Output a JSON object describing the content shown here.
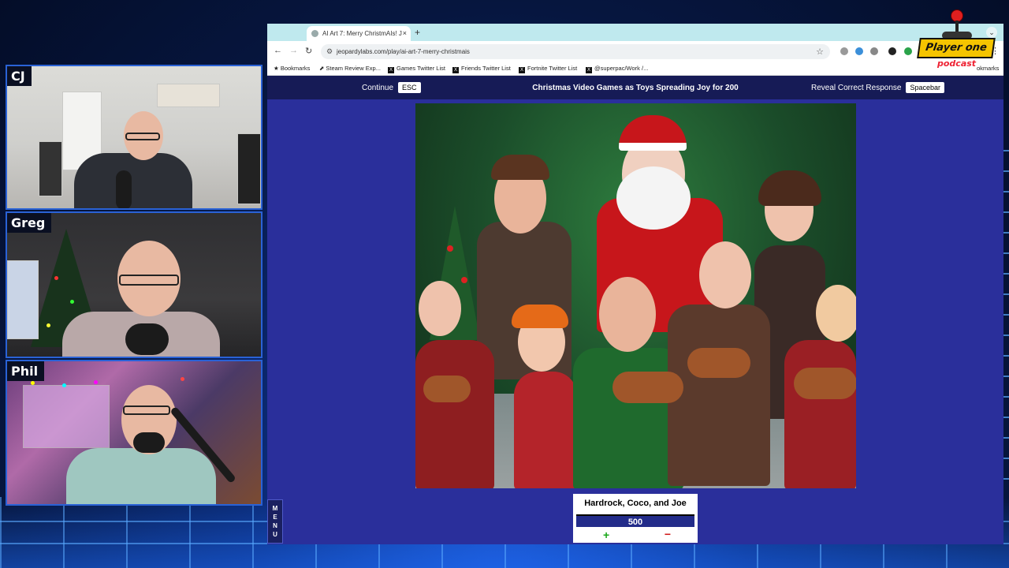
{
  "cams": {
    "cj": "CJ",
    "greg": "Greg",
    "phil": "Phil"
  },
  "browser": {
    "tab_title": "AI Art 7: Merry ChristmAIs! J",
    "tab_close": "×",
    "new_tab": "+",
    "url": "jeopardylabs.com/play/ai-art-7-merry-christmais",
    "bookmarks": [
      "Bookmarks",
      "Steam Review Exp...",
      "Games Twitter List",
      "Friends Twitter List",
      "Fortnite Twitter List",
      "@superpac/Work /...",
      "okmarks"
    ]
  },
  "game": {
    "continue_label": "Continue",
    "continue_key": "ESC",
    "question_title": "Christmas Video Games as Toys Spreading Joy for 200",
    "reveal_label": "Reveal Correct Response",
    "reveal_key": "Spacebar",
    "team_name": "Hardrock, Coco, and Joe",
    "team_score": "500",
    "plus": "+",
    "minus": "−",
    "menu_label": "MENU"
  },
  "logo": {
    "title": "Player one",
    "subtitle": "podcast"
  },
  "colors": {
    "page_bg": "#2a2f9b",
    "topbar_bg": "#161b56",
    "score_bar": "#232c8a",
    "logo_yellow": "#f5c400"
  }
}
